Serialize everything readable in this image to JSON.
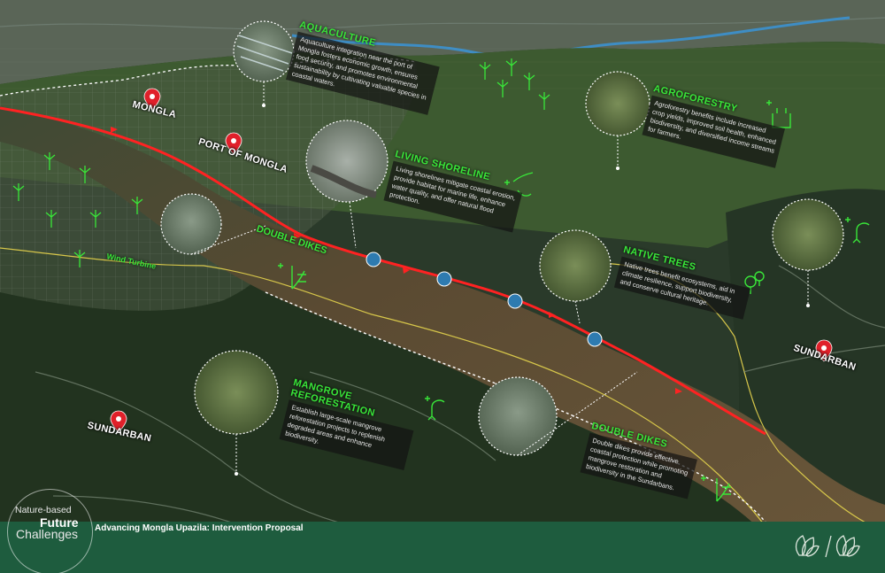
{
  "title": "Advancing Mongla Upazila: Intervention Proposal",
  "logo": {
    "line1": "Nature-based",
    "line2": "Future",
    "line3": "Challenges"
  },
  "places": {
    "mongla": "MONGLA",
    "port_of_mongla": "PORT OF MONGLA",
    "sundarban_west": "SUNDARBAN",
    "sundarban_east": "SUNDARBAN"
  },
  "labels": {
    "wind_turbine": "Wind Turbine",
    "double_dikes_upper": "DOUBLE DIKES"
  },
  "callouts": {
    "aquaculture": {
      "title": "AQUACULTURE",
      "body": "Aquaculture integration near the port of Mongla fosters economic growth, ensures food security, and promotes environmental sustainability by cultivating valuable species in coastal waters."
    },
    "agroforestry": {
      "title": "AGROFORESTRY",
      "body": "Agroforestry benefits include increased crop yields, improved soil health, enhanced biodiversity, and diversified income streams for farmers."
    },
    "living_shoreline": {
      "title": "LIVING SHORELINE",
      "body": "Living shorelines mitigate coastal erosion, provide habitat for marine life, enhance water quality, and offer natural flood protection."
    },
    "native_trees": {
      "title": "NATIVE TREES",
      "body": "Native trees benefit ecosystems, aid in climate resilience, support biodiversity, and conserve cultural heritage."
    },
    "mangrove_reforestation": {
      "title": "MANGROVE REFORESTATION",
      "body": "Establish large-scale mangrove reforestation projects to replenish degraded areas and enhance biodiversity."
    },
    "double_dikes": {
      "title": "DOUBLE DIKES",
      "body": "Double dikes provide effective coastal protection while promoting mangrove restoration and biodiversity in the Sundarbans."
    }
  },
  "colors": {
    "river": "#5a4a30",
    "route": "#ff2222",
    "accent_green": "#39e639",
    "footer": "#1e5c3e",
    "pin": "#e0202a"
  }
}
